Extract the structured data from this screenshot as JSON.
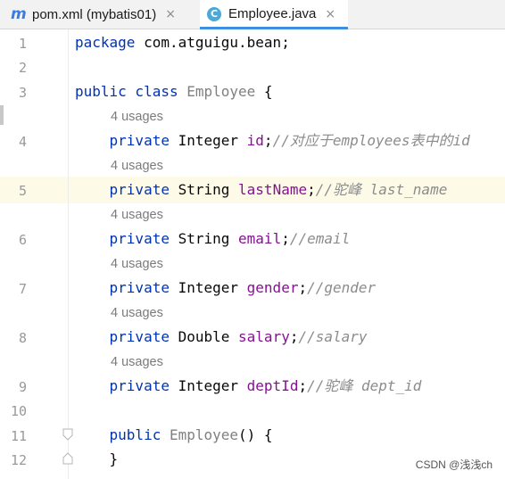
{
  "tabs": [
    {
      "icon": "m",
      "label": "pom.xml (mybatis01)",
      "close": "×",
      "active": false
    },
    {
      "icon": "C",
      "label": "Employee.java",
      "close": "×",
      "active": true
    }
  ],
  "editor": {
    "lines": [
      {
        "num": "1",
        "hint": null,
        "tokens": [
          {
            "t": "kw",
            "v": "package "
          },
          {
            "t": "plain",
            "v": "com.atguigu.bean;"
          }
        ]
      },
      {
        "num": "2",
        "hint": null,
        "tokens": []
      },
      {
        "num": "3",
        "hint": null,
        "tokens": [
          {
            "t": "kw",
            "v": "public class "
          },
          {
            "t": "cls",
            "v": "Employee"
          },
          {
            "t": "plain",
            "v": " {"
          }
        ]
      },
      {
        "num": "4",
        "hint": "4 usages",
        "tokens": [
          {
            "t": "plain",
            "v": "    "
          },
          {
            "t": "kw",
            "v": "private "
          },
          {
            "t": "plain",
            "v": "Integer "
          },
          {
            "t": "fld",
            "v": "id"
          },
          {
            "t": "plain",
            "v": ";"
          },
          {
            "t": "cmt",
            "v": "//对应于employees表中的id"
          }
        ]
      },
      {
        "num": "5",
        "hint": "4 usages",
        "tokens": [
          {
            "t": "plain",
            "v": "    "
          },
          {
            "t": "kw",
            "v": "private "
          },
          {
            "t": "plain",
            "v": "String "
          },
          {
            "t": "fld",
            "v": "lastName"
          },
          {
            "t": "plain",
            "v": ";"
          },
          {
            "t": "cmt",
            "v": "//驼峰 last_name"
          }
        ]
      },
      {
        "num": "6",
        "hint": "4 usages",
        "tokens": [
          {
            "t": "plain",
            "v": "    "
          },
          {
            "t": "kw",
            "v": "private "
          },
          {
            "t": "plain",
            "v": "String "
          },
          {
            "t": "fld",
            "v": "email"
          },
          {
            "t": "plain",
            "v": ";"
          },
          {
            "t": "cmt",
            "v": "//email"
          }
        ]
      },
      {
        "num": "7",
        "hint": "4 usages",
        "tokens": [
          {
            "t": "plain",
            "v": "    "
          },
          {
            "t": "kw",
            "v": "private "
          },
          {
            "t": "plain",
            "v": "Integer "
          },
          {
            "t": "fld",
            "v": "gender"
          },
          {
            "t": "plain",
            "v": ";"
          },
          {
            "t": "cmt",
            "v": "//gender"
          }
        ]
      },
      {
        "num": "8",
        "hint": "4 usages",
        "tokens": [
          {
            "t": "plain",
            "v": "    "
          },
          {
            "t": "kw",
            "v": "private "
          },
          {
            "t": "plain",
            "v": "Double "
          },
          {
            "t": "fld",
            "v": "salary"
          },
          {
            "t": "plain",
            "v": ";"
          },
          {
            "t": "cmt",
            "v": "//salary"
          }
        ]
      },
      {
        "num": "9",
        "hint": "4 usages",
        "tokens": [
          {
            "t": "plain",
            "v": "    "
          },
          {
            "t": "kw",
            "v": "private "
          },
          {
            "t": "plain",
            "v": "Integer "
          },
          {
            "t": "fld",
            "v": "deptId"
          },
          {
            "t": "plain",
            "v": ";"
          },
          {
            "t": "cmt",
            "v": "//驼峰 dept_id"
          }
        ]
      },
      {
        "num": "10",
        "hint": null,
        "tokens": []
      },
      {
        "num": "11",
        "hint": null,
        "tokens": [
          {
            "t": "plain",
            "v": "    "
          },
          {
            "t": "kw",
            "v": "public "
          },
          {
            "t": "cls",
            "v": "Employee"
          },
          {
            "t": "plain",
            "v": "() {"
          }
        ]
      },
      {
        "num": "12",
        "hint": null,
        "tokens": [
          {
            "t": "plain",
            "v": "    }"
          }
        ]
      }
    ],
    "current_line": "5"
  },
  "watermark": "CSDN @浅浅ch",
  "colors": {
    "keyword": "#0033b3",
    "field": "#871094",
    "comment": "#8c8c8c",
    "class_name": "#808080",
    "active_tab_underline": "#3f8fe0",
    "caret_line": "#fdfbe8"
  }
}
